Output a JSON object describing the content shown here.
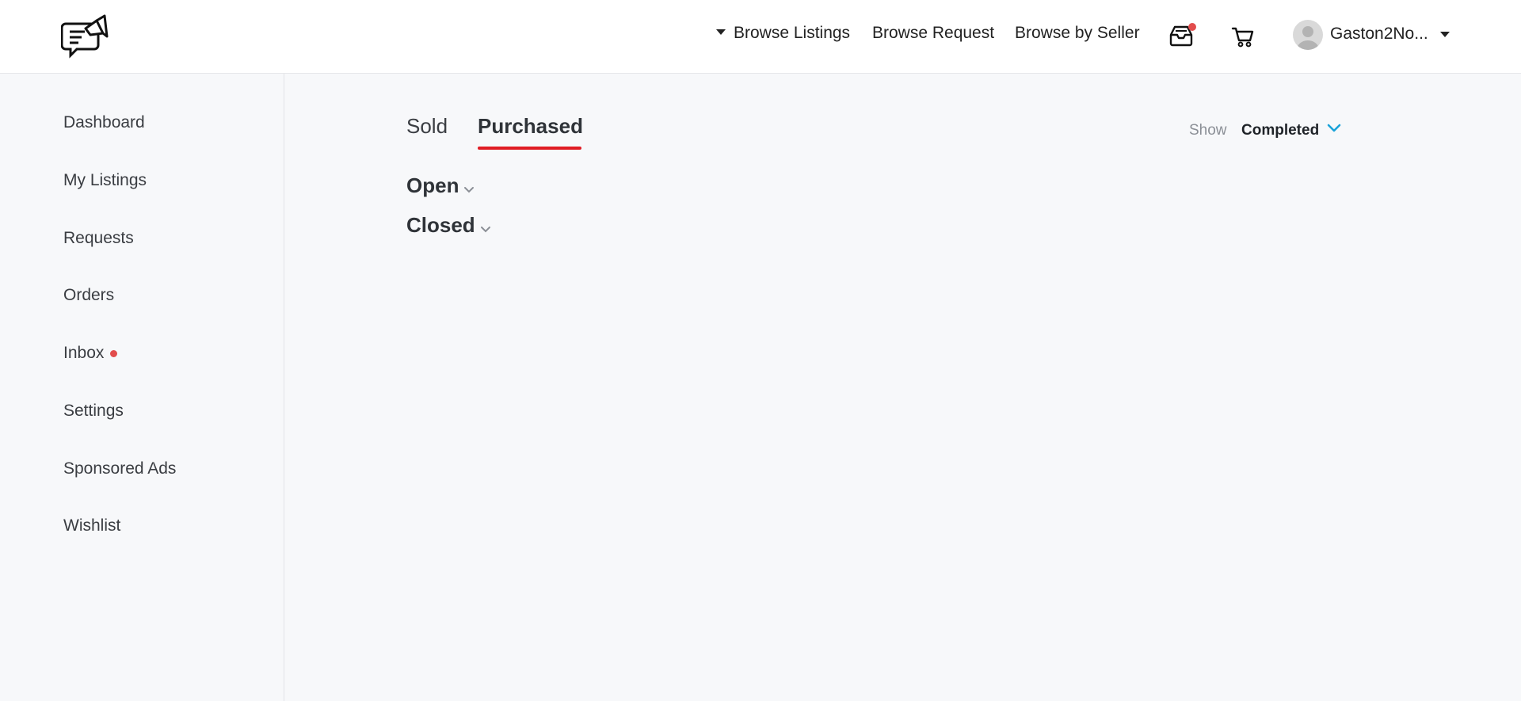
{
  "header": {
    "logo_icon": "megaphone-chat-icon",
    "nav": {
      "browse_listings": "Browse Listings",
      "browse_request": "Browse Request",
      "browse_by_seller": "Browse by Seller"
    },
    "inbox_icon": "inbox-tray-icon",
    "cart_icon": "cart-icon",
    "user_name": "Gaston2No..."
  },
  "sidebar": {
    "items": [
      {
        "label": "Dashboard"
      },
      {
        "label": "My Listings"
      },
      {
        "label": "Requests"
      },
      {
        "label": "Orders"
      },
      {
        "label": "Inbox",
        "has_dot": true
      },
      {
        "label": "Settings"
      },
      {
        "label": "Sponsored Ads"
      },
      {
        "label": "Wishlist"
      }
    ]
  },
  "main": {
    "tabs": [
      {
        "label": "Sold",
        "active": false
      },
      {
        "label": "Purchased",
        "active": true
      }
    ],
    "filter": {
      "label": "Show",
      "value": "Completed"
    },
    "sections": [
      {
        "label": "Open"
      },
      {
        "label": "Closed"
      }
    ]
  },
  "colors": {
    "accent_red": "#e01c24",
    "notification": "#e24c4c",
    "link_blue": "#1aa3d9"
  }
}
